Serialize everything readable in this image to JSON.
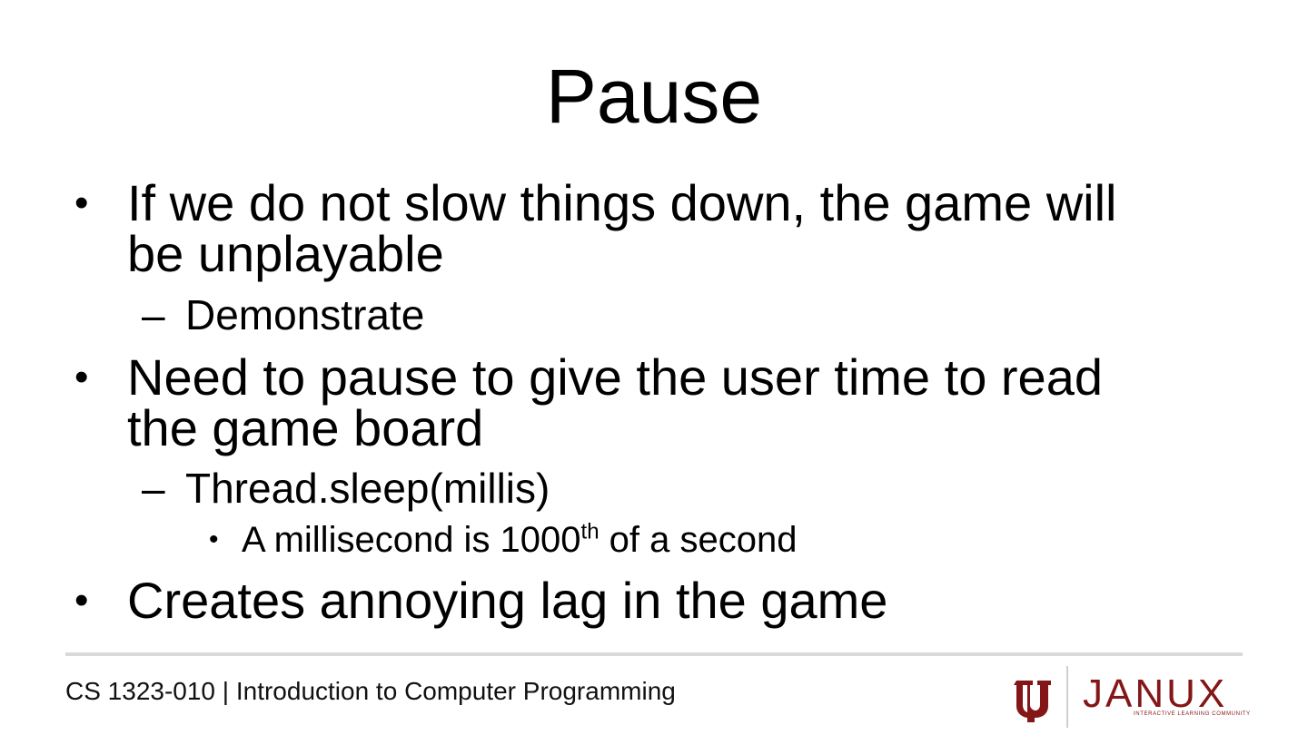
{
  "slide": {
    "title": "Pause",
    "bullets": [
      {
        "line1": "If we do not slow things down, the game will",
        "line2": "be unplayable",
        "sub": "Demonstrate"
      },
      {
        "line1": "Need to pause to give the user time to read",
        "line2": "the game board",
        "sub": "Thread.sleep(millis)",
        "subsub_pre": "A millisecond is 1000",
        "subsub_sup": "th",
        "subsub_post": " of a second"
      },
      {
        "line1": "Creates annoying lag in the game"
      }
    ]
  },
  "symbols": {
    "bullet": "•",
    "dash": "–"
  },
  "footer": {
    "course": "CS 1323-010 | Introduction to Computer Programming",
    "logo_text": "JANUX",
    "logo_tagline": "INTERACTIVE LEARNING COMMUNITY",
    "logo_icon": "ou-logo-icon",
    "brand_color": "#841617"
  }
}
